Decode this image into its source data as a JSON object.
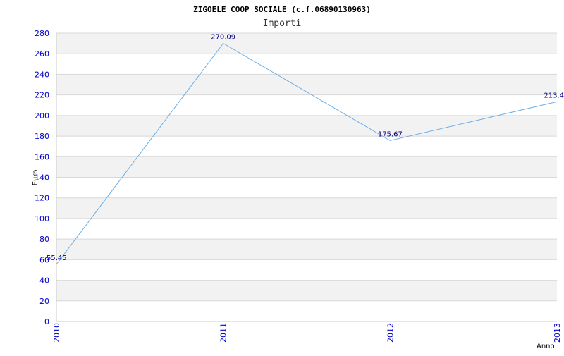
{
  "chart_data": {
    "type": "line",
    "title": "ZIGOELE COOP SOCIALE (c.f.06890130963)",
    "subtitle": "Importi",
    "xlabel": "Anno",
    "ylabel": "Euro",
    "categories": [
      "2010",
      "2011",
      "2012",
      "2013"
    ],
    "series": [
      {
        "values": [
          55.45,
          270.09,
          175.67,
          213.4
        ]
      }
    ],
    "data_labels": [
      "55.45",
      "270.09",
      "175.67",
      "213.4"
    ],
    "ylim": [
      0,
      280
    ],
    "yticks": [
      "0",
      "20",
      "40",
      "60",
      "80",
      "100",
      "120",
      "140",
      "160",
      "180",
      "200",
      "220",
      "240",
      "260",
      "280"
    ],
    "grid": true,
    "legend": "none",
    "colors": {
      "line": "#6aaee8",
      "band": "#f2f2f2",
      "gridline": "#d8d8d8",
      "tick_text": "#0000cc",
      "data_label": "#000080"
    }
  }
}
